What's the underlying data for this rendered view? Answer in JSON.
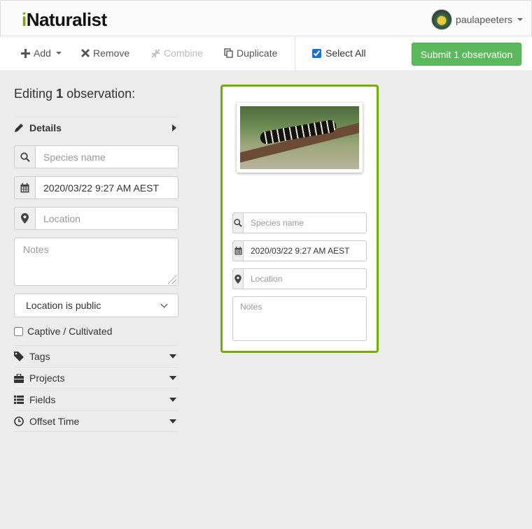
{
  "header": {
    "logo_i": "i",
    "logo_rest": "Naturalist",
    "username": "paulapeeters"
  },
  "toolbar": {
    "add_label": "Add",
    "remove_label": "Remove",
    "combine_label": "Combine",
    "duplicate_label": "Duplicate",
    "select_all_label": "Select All",
    "select_all_checked": true,
    "submit_label": "Submit 1 observation"
  },
  "left": {
    "heading_prefix": "Editing",
    "heading_count": "1",
    "heading_suffix": "observation:",
    "details_label": "Details",
    "species_placeholder": "Species name",
    "date_value": "2020/03/22 9:27 AM AEST",
    "location_placeholder": "Location",
    "notes_placeholder": "Notes",
    "geoprivacy_value": "Location is public",
    "captive_label": "Captive / Cultivated",
    "sections": [
      {
        "label": "Tags",
        "icon": "tag-icon"
      },
      {
        "label": "Projects",
        "icon": "briefcase-icon"
      },
      {
        "label": "Fields",
        "icon": "list-icon"
      },
      {
        "label": "Offset Time",
        "icon": "clock-icon"
      }
    ]
  },
  "card": {
    "species_placeholder": "Species name",
    "date_value": "2020/03/22 9:27 AM AEST",
    "location_placeholder": "Location",
    "notes_placeholder": "Notes",
    "photo_subject": "caterpillar-on-branch-photo",
    "accent_color": "#74ac00"
  },
  "colors": {
    "brand_green": "#74ac00",
    "submit_green": "#5cb85c"
  }
}
